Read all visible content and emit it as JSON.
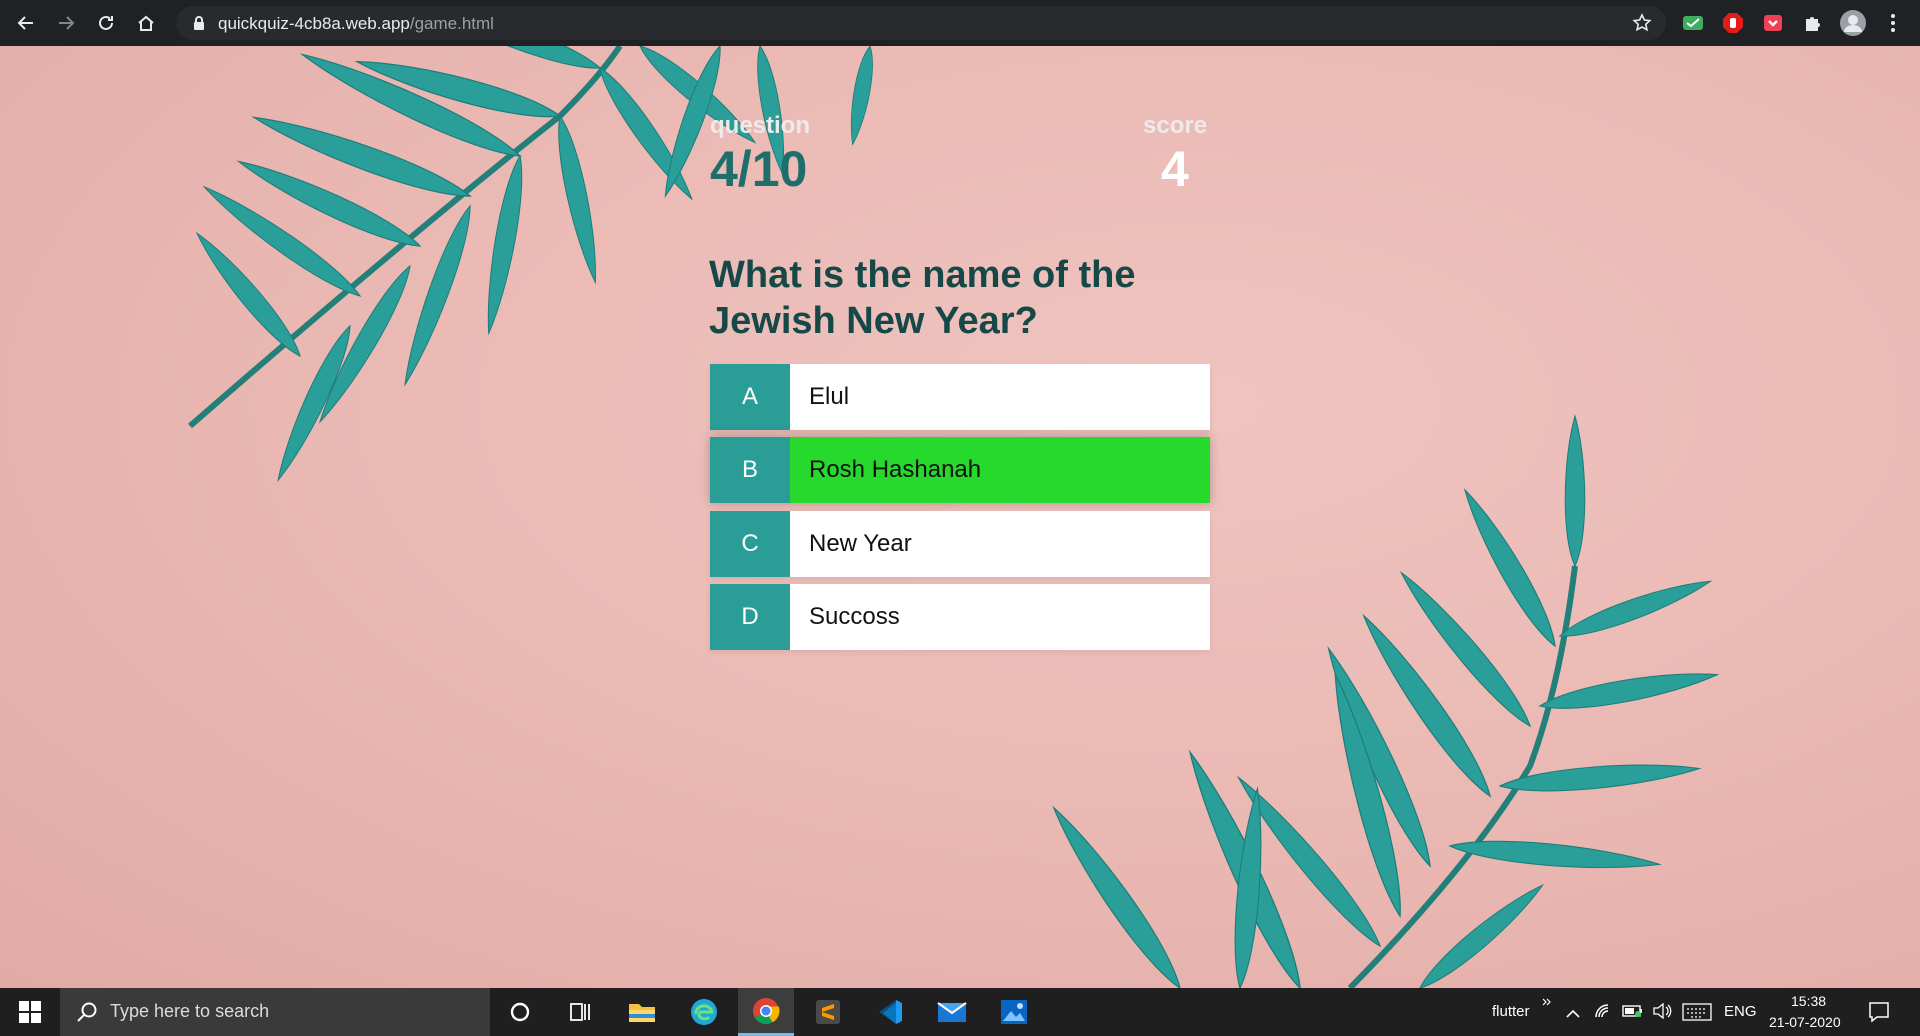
{
  "browser": {
    "url_host": "quickquiz-4cb8a.web.app",
    "url_path": "/game.html"
  },
  "hud": {
    "question_label": "question",
    "question_progress": "4/10",
    "score_label": "score",
    "score_value": "4"
  },
  "quiz": {
    "question": "What is the name of the Jewish New Year?",
    "choices": [
      {
        "prefix": "A",
        "text": "Elul"
      },
      {
        "prefix": "B",
        "text": "Rosh Hashanah"
      },
      {
        "prefix": "C",
        "text": "New Year"
      },
      {
        "prefix": "D",
        "text": "Succoss"
      }
    ],
    "correct_choice": "B"
  },
  "colors": {
    "accent_teal": "#2a9d97",
    "correct_green": "#28d92d",
    "question_text": "#154847",
    "background_pink": "#e9b7b2"
  },
  "taskbar": {
    "search_placeholder": "Type here to search",
    "pinned_apps": [
      "cortana-icon",
      "task-view-icon",
      "file-explorer-icon",
      "edge-icon",
      "chrome-icon",
      "sublime-text-icon",
      "vscode-icon",
      "mail-icon",
      "photos-icon"
    ],
    "tray_label": "flutter",
    "language": "ENG",
    "time": "15:38",
    "date": "21-07-2020"
  }
}
